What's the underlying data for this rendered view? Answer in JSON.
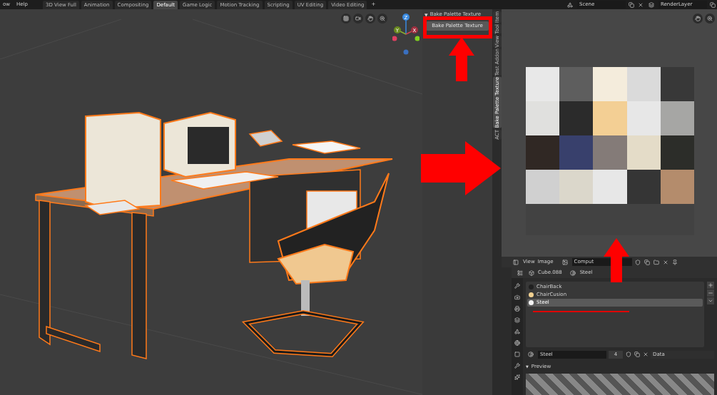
{
  "menu": [
    "ow",
    "Help"
  ],
  "workspaces": [
    {
      "label": "3D View Full",
      "selected": false
    },
    {
      "label": "Animation",
      "selected": false
    },
    {
      "label": "Compositing",
      "selected": false
    },
    {
      "label": "Default",
      "selected": true
    },
    {
      "label": "Game Logic",
      "selected": false
    },
    {
      "label": "Motion Tracking",
      "selected": false
    },
    {
      "label": "Scripting",
      "selected": false
    },
    {
      "label": "UV Editing",
      "selected": false
    },
    {
      "label": "Video Editing",
      "selected": false
    }
  ],
  "add_workspace": "+",
  "scene": "Scene",
  "view_layer": "RenderLayer",
  "gizmo": {
    "z": "Z",
    "y": "Y",
    "x": "X"
  },
  "sidebar": {
    "panel": {
      "toggle": "▼",
      "title": "Bake Palette Texture",
      "expanded": true,
      "button": "Bake Palette Texture"
    },
    "tabs": [
      {
        "label": "Item",
        "selected": false
      },
      {
        "label": "Tool",
        "selected": false
      },
      {
        "label": "View",
        "selected": false
      },
      {
        "label": "Test Addon",
        "selected": false
      },
      {
        "label": "Bake Palette Texture",
        "selected": true
      },
      {
        "label": "ACT",
        "selected": false
      }
    ]
  },
  "palette": [
    {
      "color": "#e8e8e8"
    },
    {
      "color": "#5e5e5e"
    },
    {
      "color": "#f4ecdc"
    },
    {
      "color": "#dadada"
    },
    {
      "color": "#383838"
    },
    {
      "color": "#e0e0de"
    },
    {
      "color": "#2b2b2b"
    },
    {
      "color": "#f3cf94"
    },
    {
      "color": "#e7e7e7"
    },
    {
      "color": "#a6a6a4"
    },
    {
      "color": "#302824"
    },
    {
      "color": "#38406c"
    },
    {
      "color": "#847b78"
    },
    {
      "color": "#e4dcc8"
    },
    {
      "color": "#2c2d29"
    },
    {
      "color": "#d0d0d0"
    },
    {
      "color": "#dbd7cb"
    },
    {
      "color": "#e7e7e7"
    },
    {
      "color": "#353535"
    },
    {
      "color": "#b48c6c"
    }
  ],
  "image_editor": {
    "menu": [
      "View",
      "Image"
    ],
    "image_name": "Comput"
  },
  "properties": {
    "object": "Cube.088",
    "material": "Steel",
    "slots": [
      {
        "name": "ChairBack",
        "color": "#202020",
        "selected": false
      },
      {
        "name": "ChairCusion",
        "color": "#f0d090",
        "selected": false
      },
      {
        "name": "Steel",
        "color": "#f4f4f4",
        "selected": true
      }
    ],
    "material_name": "Steel",
    "users": "4",
    "link": "Data",
    "preview": {
      "toggle": "▼",
      "title": "Preview"
    }
  }
}
